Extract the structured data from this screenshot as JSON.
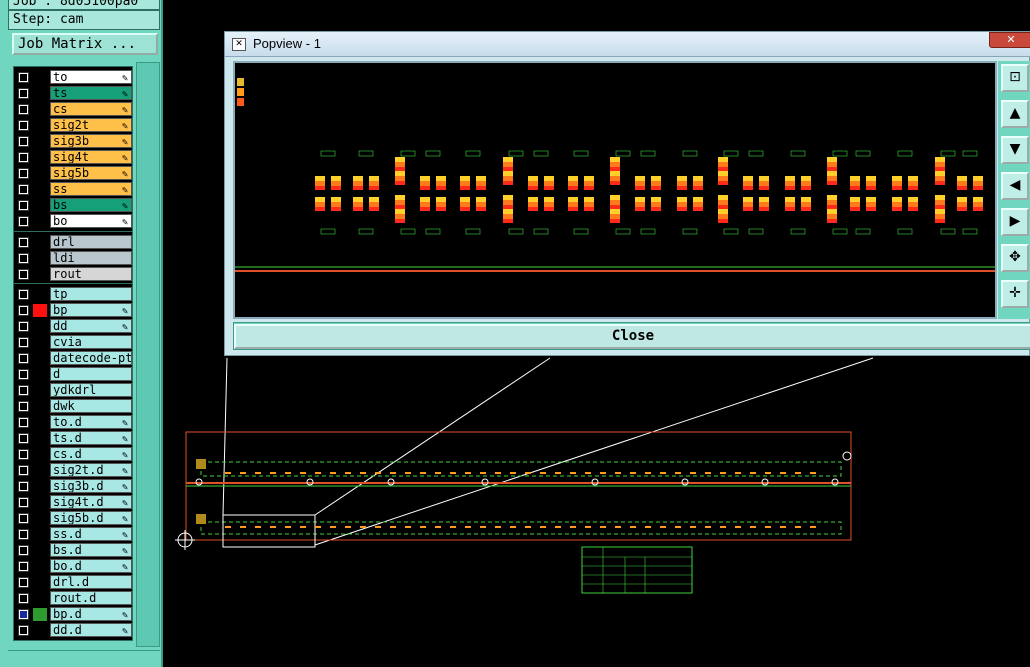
{
  "left_panel": {
    "job_label": "Job : ",
    "job_value": "8d05100pa0",
    "step_label": "Step: ",
    "step_value": "cam",
    "job_matrix_button": "Job Matrix ...",
    "board_layers": [
      {
        "name": "to",
        "color": "#ffffff",
        "pen": true
      },
      {
        "name": "ts",
        "color": "#16a07a",
        "pen": true
      },
      {
        "name": "cs",
        "color": "#ffc04a",
        "pen": true
      },
      {
        "name": "sig2t",
        "color": "#ffc04a",
        "pen": true
      },
      {
        "name": "sig3b",
        "color": "#ffc04a",
        "pen": true
      },
      {
        "name": "sig4t",
        "color": "#ffc04a",
        "pen": true
      },
      {
        "name": "sig5b",
        "color": "#ffc04a",
        "pen": true
      },
      {
        "name": "ss",
        "color": "#ffc04a",
        "pen": true
      },
      {
        "name": "bs",
        "color": "#16a07a",
        "pen": true
      },
      {
        "name": "bo",
        "color": "#ffffff",
        "pen": true
      }
    ],
    "drill_layers": [
      {
        "name": "drl",
        "color": "#b8c6ce"
      },
      {
        "name": "ldi",
        "color": "#b8c6ce"
      },
      {
        "name": "rout",
        "color": "#d6d6d6"
      }
    ],
    "misc_layers": [
      {
        "name": "tp",
        "swatch": "",
        "pen": false,
        "checked": false
      },
      {
        "name": "bp",
        "swatch": "#ff1010",
        "pen": true,
        "checked": false
      },
      {
        "name": "dd",
        "swatch": "",
        "pen": true,
        "checked": false
      },
      {
        "name": "cvia",
        "swatch": "",
        "pen": false,
        "checked": false
      },
      {
        "name": "datecode-pte",
        "swatch": "",
        "pen": false,
        "checked": false
      },
      {
        "name": "d",
        "swatch": "",
        "pen": false,
        "checked": false
      },
      {
        "name": "ydkdrl",
        "swatch": "",
        "pen": false,
        "checked": false
      },
      {
        "name": "dwk",
        "swatch": "",
        "pen": false,
        "checked": false
      },
      {
        "name": "to.d",
        "swatch": "",
        "pen": true,
        "checked": false
      },
      {
        "name": "ts.d",
        "swatch": "",
        "pen": true,
        "checked": false
      },
      {
        "name": "cs.d",
        "swatch": "",
        "pen": true,
        "checked": false
      },
      {
        "name": "sig2t.d",
        "swatch": "",
        "pen": true,
        "checked": false
      },
      {
        "name": "sig3b.d",
        "swatch": "",
        "pen": true,
        "checked": false
      },
      {
        "name": "sig4t.d",
        "swatch": "",
        "pen": true,
        "checked": false
      },
      {
        "name": "sig5b.d",
        "swatch": "",
        "pen": true,
        "checked": false
      },
      {
        "name": "ss.d",
        "swatch": "",
        "pen": true,
        "checked": false
      },
      {
        "name": "bs.d",
        "swatch": "",
        "pen": true,
        "checked": false
      },
      {
        "name": "bo.d",
        "swatch": "",
        "pen": true,
        "checked": false
      },
      {
        "name": "drl.d",
        "swatch": "",
        "pen": false,
        "checked": false
      },
      {
        "name": "rout.d",
        "swatch": "",
        "pen": false,
        "checked": false
      },
      {
        "name": "bp.d",
        "swatch": "#2f9a2f",
        "pen": true,
        "checked": true
      },
      {
        "name": "dd.d",
        "swatch": "",
        "pen": true,
        "checked": false
      }
    ]
  },
  "popview": {
    "title": "Popview - 1",
    "close_button": "Close",
    "window_close_glyph": "✕",
    "tools": [
      "zoom-home-icon",
      "pan-up-icon",
      "pan-down-icon",
      "pan-left-icon",
      "pan-right-icon",
      "zoom-in-icon",
      "zoom-out-icon"
    ],
    "tool_glyphs": [
      "⊡",
      "▲",
      "▼",
      "◀",
      "▶",
      "✥",
      "✛"
    ]
  },
  "colors": {
    "panel_teal": "#70d6c0",
    "trace_green": "#3fd43f",
    "pad_orange": "#ff9a1a",
    "pad_red": "#ff2a1a",
    "outline_red": "#e0502a"
  }
}
